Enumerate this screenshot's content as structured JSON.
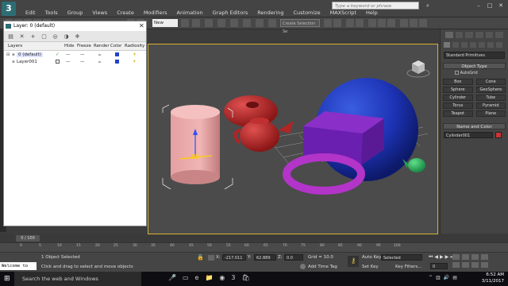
{
  "app": {
    "logo": "3",
    "menus": [
      "Edit",
      "Tools",
      "Group",
      "Views",
      "Create",
      "Modifiers",
      "Animation",
      "Graph Editors",
      "Rendering",
      "Customize",
      "MAXScript",
      "Help"
    ],
    "search_placeholder": "Type a keyword or phrase"
  },
  "toolbar": {
    "new_dropdown": "New",
    "selection_set": "Create Selection Se"
  },
  "layer_dialog": {
    "title": "Layer: 0 (default)",
    "columns": [
      "Layers",
      "Hide",
      "Freeze",
      "Render",
      "Color",
      "Radiosity"
    ],
    "rows": [
      {
        "name": "0 (default)",
        "hide": "—",
        "freeze": "—",
        "render": "",
        "color": "#2244cc"
      },
      {
        "name": "Layer001",
        "hide": "—",
        "freeze": "—",
        "render": "",
        "color": "#2244cc"
      }
    ]
  },
  "command_panel": {
    "category_dropdown": "Standard Primitives",
    "object_type_header": "Object Type",
    "autogrid_label": "AutoGrid",
    "object_buttons": [
      "Box",
      "Cone",
      "Sphere",
      "GeoSphere",
      "Cylinder",
      "Tube",
      "Torus",
      "Pyramid",
      "Teapot",
      "Plane"
    ],
    "name_color_header": "Name and Color",
    "object_name": "Cylinder001",
    "object_color": "#cc3333"
  },
  "timeline": {
    "counter": "0 / 100",
    "ticks": [
      "0",
      "5",
      "10",
      "15",
      "20",
      "25",
      "30",
      "35",
      "40",
      "45",
      "50",
      "55",
      "60",
      "65",
      "70",
      "75",
      "80",
      "85",
      "90",
      "95",
      "100"
    ]
  },
  "status": {
    "listener": "Welcome to",
    "selected": "1 Object Selected",
    "prompt": "Click and drag to select and move objects",
    "x_label": "X:",
    "x_value": "-217.011",
    "y_label": "Y:",
    "y_value": "62.889",
    "z_label": "Z:",
    "z_value": "0.0",
    "grid": "Grid = 10.0",
    "add_time_tag": "Add Time Tag",
    "auto_key": "Auto Key",
    "set_key_mode": "Selected",
    "set_key": "Set Key",
    "key_filters": "Key Filters...",
    "frame": "0"
  },
  "taskbar": {
    "search_text": "Search the web and Windows",
    "time": "6:52 AM",
    "date": "3/11/2017"
  },
  "scene_colors": {
    "viewport_bg": "#4b4b4b",
    "selection_border": "#d8b030"
  }
}
